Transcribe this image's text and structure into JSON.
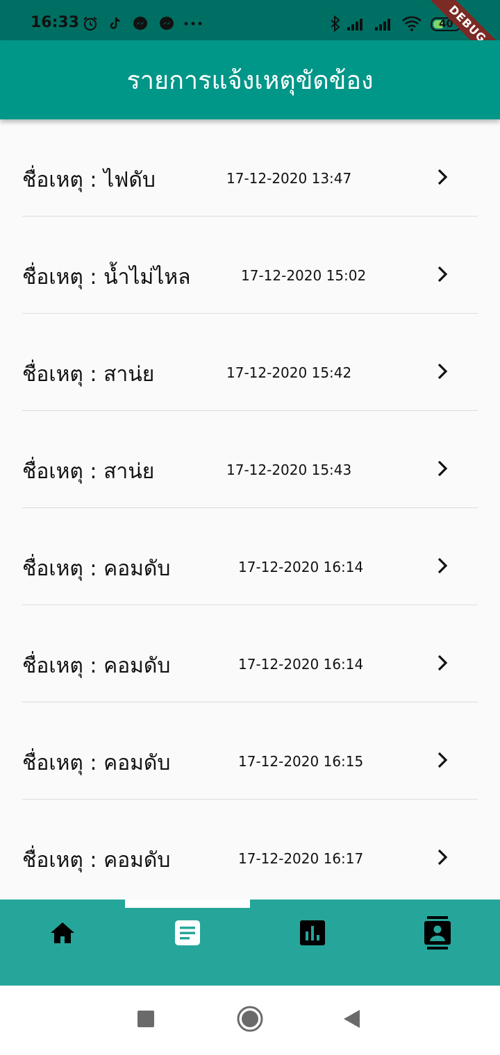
{
  "status_bar": {
    "time": "16:33",
    "icons": [
      "alarm-icon",
      "tiktok-icon",
      "messenger-icon",
      "messenger-icon",
      "more-icon",
      "bluetooth-icon",
      "signal-icon",
      "signal-icon",
      "wifi-icon",
      "battery-icon"
    ],
    "battery": "40",
    "debug_label": "DEBUG"
  },
  "app_bar": {
    "title": "รายการแจ้งเหตุขัดข้อง"
  },
  "incidents": [
    {
      "label": "ชื่อเหตุ : ไฟดับ",
      "date": "17-12-2020 13:47"
    },
    {
      "label": "ชื่อเหตุ : น้ำไม่ไหล",
      "date": "17-12-2020 15:02"
    },
    {
      "label": "ชื่อเหตุ : สาน่ย",
      "date": "17-12-2020 15:42"
    },
    {
      "label": "ชื่อเหตุ : สาน่ย",
      "date": "17-12-2020 15:43"
    },
    {
      "label": "ชื่อเหตุ : คอมดับ",
      "date": "17-12-2020 16:14"
    },
    {
      "label": "ชื่อเหตุ : คอมดับ",
      "date": "17-12-2020 16:14"
    },
    {
      "label": "ชื่อเหตุ : คอมดับ",
      "date": "17-12-2020 16:15"
    },
    {
      "label": "ชื่อเหตุ : คอมดับ",
      "date": "17-12-2020 16:17"
    }
  ],
  "bottom_nav": {
    "items": [
      {
        "icon": "home-icon",
        "selected": false
      },
      {
        "icon": "article-icon",
        "selected": true
      },
      {
        "icon": "bar-chart-icon",
        "selected": false
      },
      {
        "icon": "contacts-icon",
        "selected": false
      }
    ]
  },
  "colors": {
    "status_bar": "#006f63",
    "app_bar": "#009688",
    "bottom_nav": "#26a69a",
    "list_background": "#fafafa"
  }
}
